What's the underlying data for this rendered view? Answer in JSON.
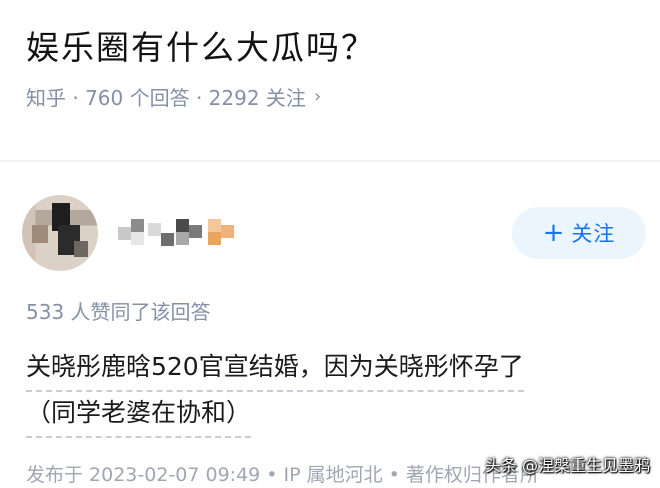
{
  "question": {
    "title": "娱乐圈有什么大瓜吗？",
    "meta": "知乎 · 760 个回答 · 2292 关注",
    "chevron": "›"
  },
  "author": {
    "avatar": "avatar-blurred",
    "name_redacted": true
  },
  "follow_button": {
    "plus": "+",
    "label": "关注",
    "color": "#1772f6",
    "bg": "#ebf5fd"
  },
  "likes_text": "533 人赞同了该回答",
  "answer": {
    "lines": [
      "关晓彤鹿晗520官宣结婚，因为关晓彤怀孕了",
      "（同学老婆在协和）"
    ]
  },
  "footer": "发布于 2023-02-07 09:49 • IP 属地河北 • 著作权归作者所",
  "watermark": "头条 @涅槃重生见墨鸦",
  "colors": {
    "meta": "#8590a6",
    "accent": "#1772f6"
  }
}
